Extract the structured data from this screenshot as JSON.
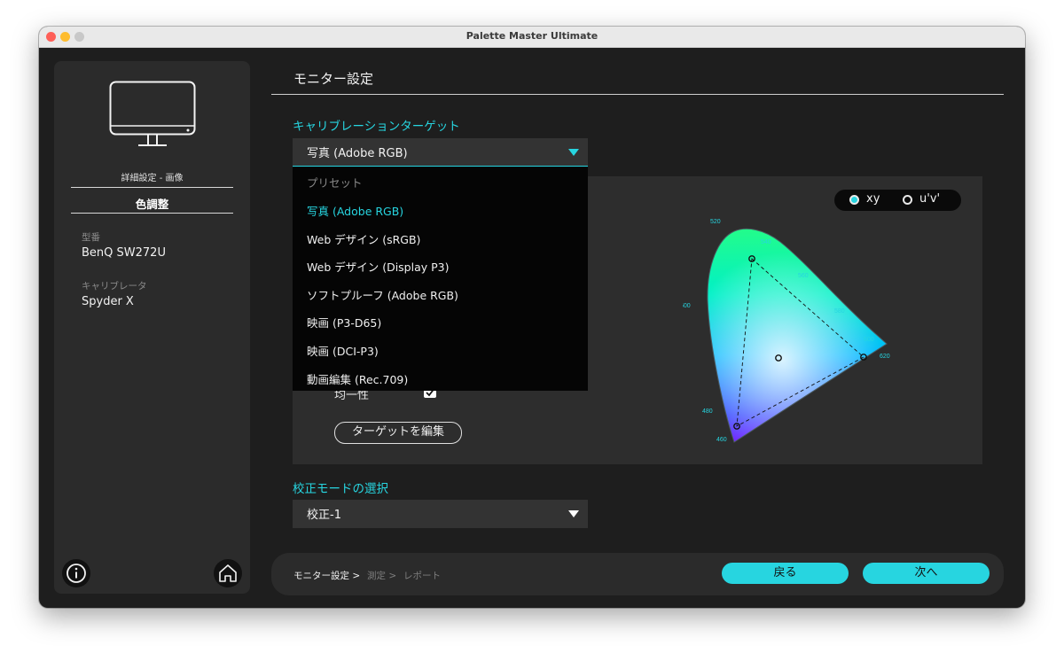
{
  "window": {
    "title": "Palette Master Ultimate"
  },
  "sidebar": {
    "subtitle": "詳細設定 - 画像",
    "active_item": "色調整",
    "model_label": "型番",
    "model_value": "BenQ SW272U",
    "calibrator_label": "キャリブレータ",
    "calibrator_value": "Spyder X"
  },
  "main": {
    "title": "モニター設定",
    "calibration_target_label": "キャリブレーションターゲット",
    "calibration_target_value": "写真 (Adobe RGB)",
    "dropdown": {
      "header": "プリセット",
      "selected_index": 0,
      "options": [
        "写真 (Adobe RGB)",
        "Web デザイン (sRGB)",
        "Web デザイン (Display P3)",
        "ソフトプルーフ (Adobe RGB)",
        "映画 (P3-D65)",
        "映画 (DCI-P3)",
        "動画編集 (Rec.709)"
      ]
    },
    "uniformity_label": "均一性",
    "uniformity_checked": true,
    "edit_target_button": "ターゲットを編集",
    "chart_toggle": {
      "xy": "xy",
      "uv": "u'v'",
      "selected": "xy"
    },
    "wavelength_ticks": [
      "520",
      "540",
      "560",
      "580",
      "600",
      "620",
      "500",
      "480",
      "460"
    ],
    "calibration_mode_label": "校正モードの選択",
    "calibration_mode_value": "校正-1"
  },
  "footer": {
    "breadcrumb": [
      "モニター設定 >",
      "測定 >",
      "レポート"
    ],
    "back_button": "戻る",
    "next_button": "次へ"
  },
  "colors": {
    "accent": "#27d5e0",
    "window_bg": "#1e1e1e",
    "sidebar_bg": "#2b2b2b",
    "panel_bg": "#2d2d2d",
    "dropdown_bg": "#050505"
  },
  "icons": [
    "monitor-icon",
    "info-icon",
    "home-icon",
    "chevron-down-icon",
    "checkmark-icon"
  ]
}
